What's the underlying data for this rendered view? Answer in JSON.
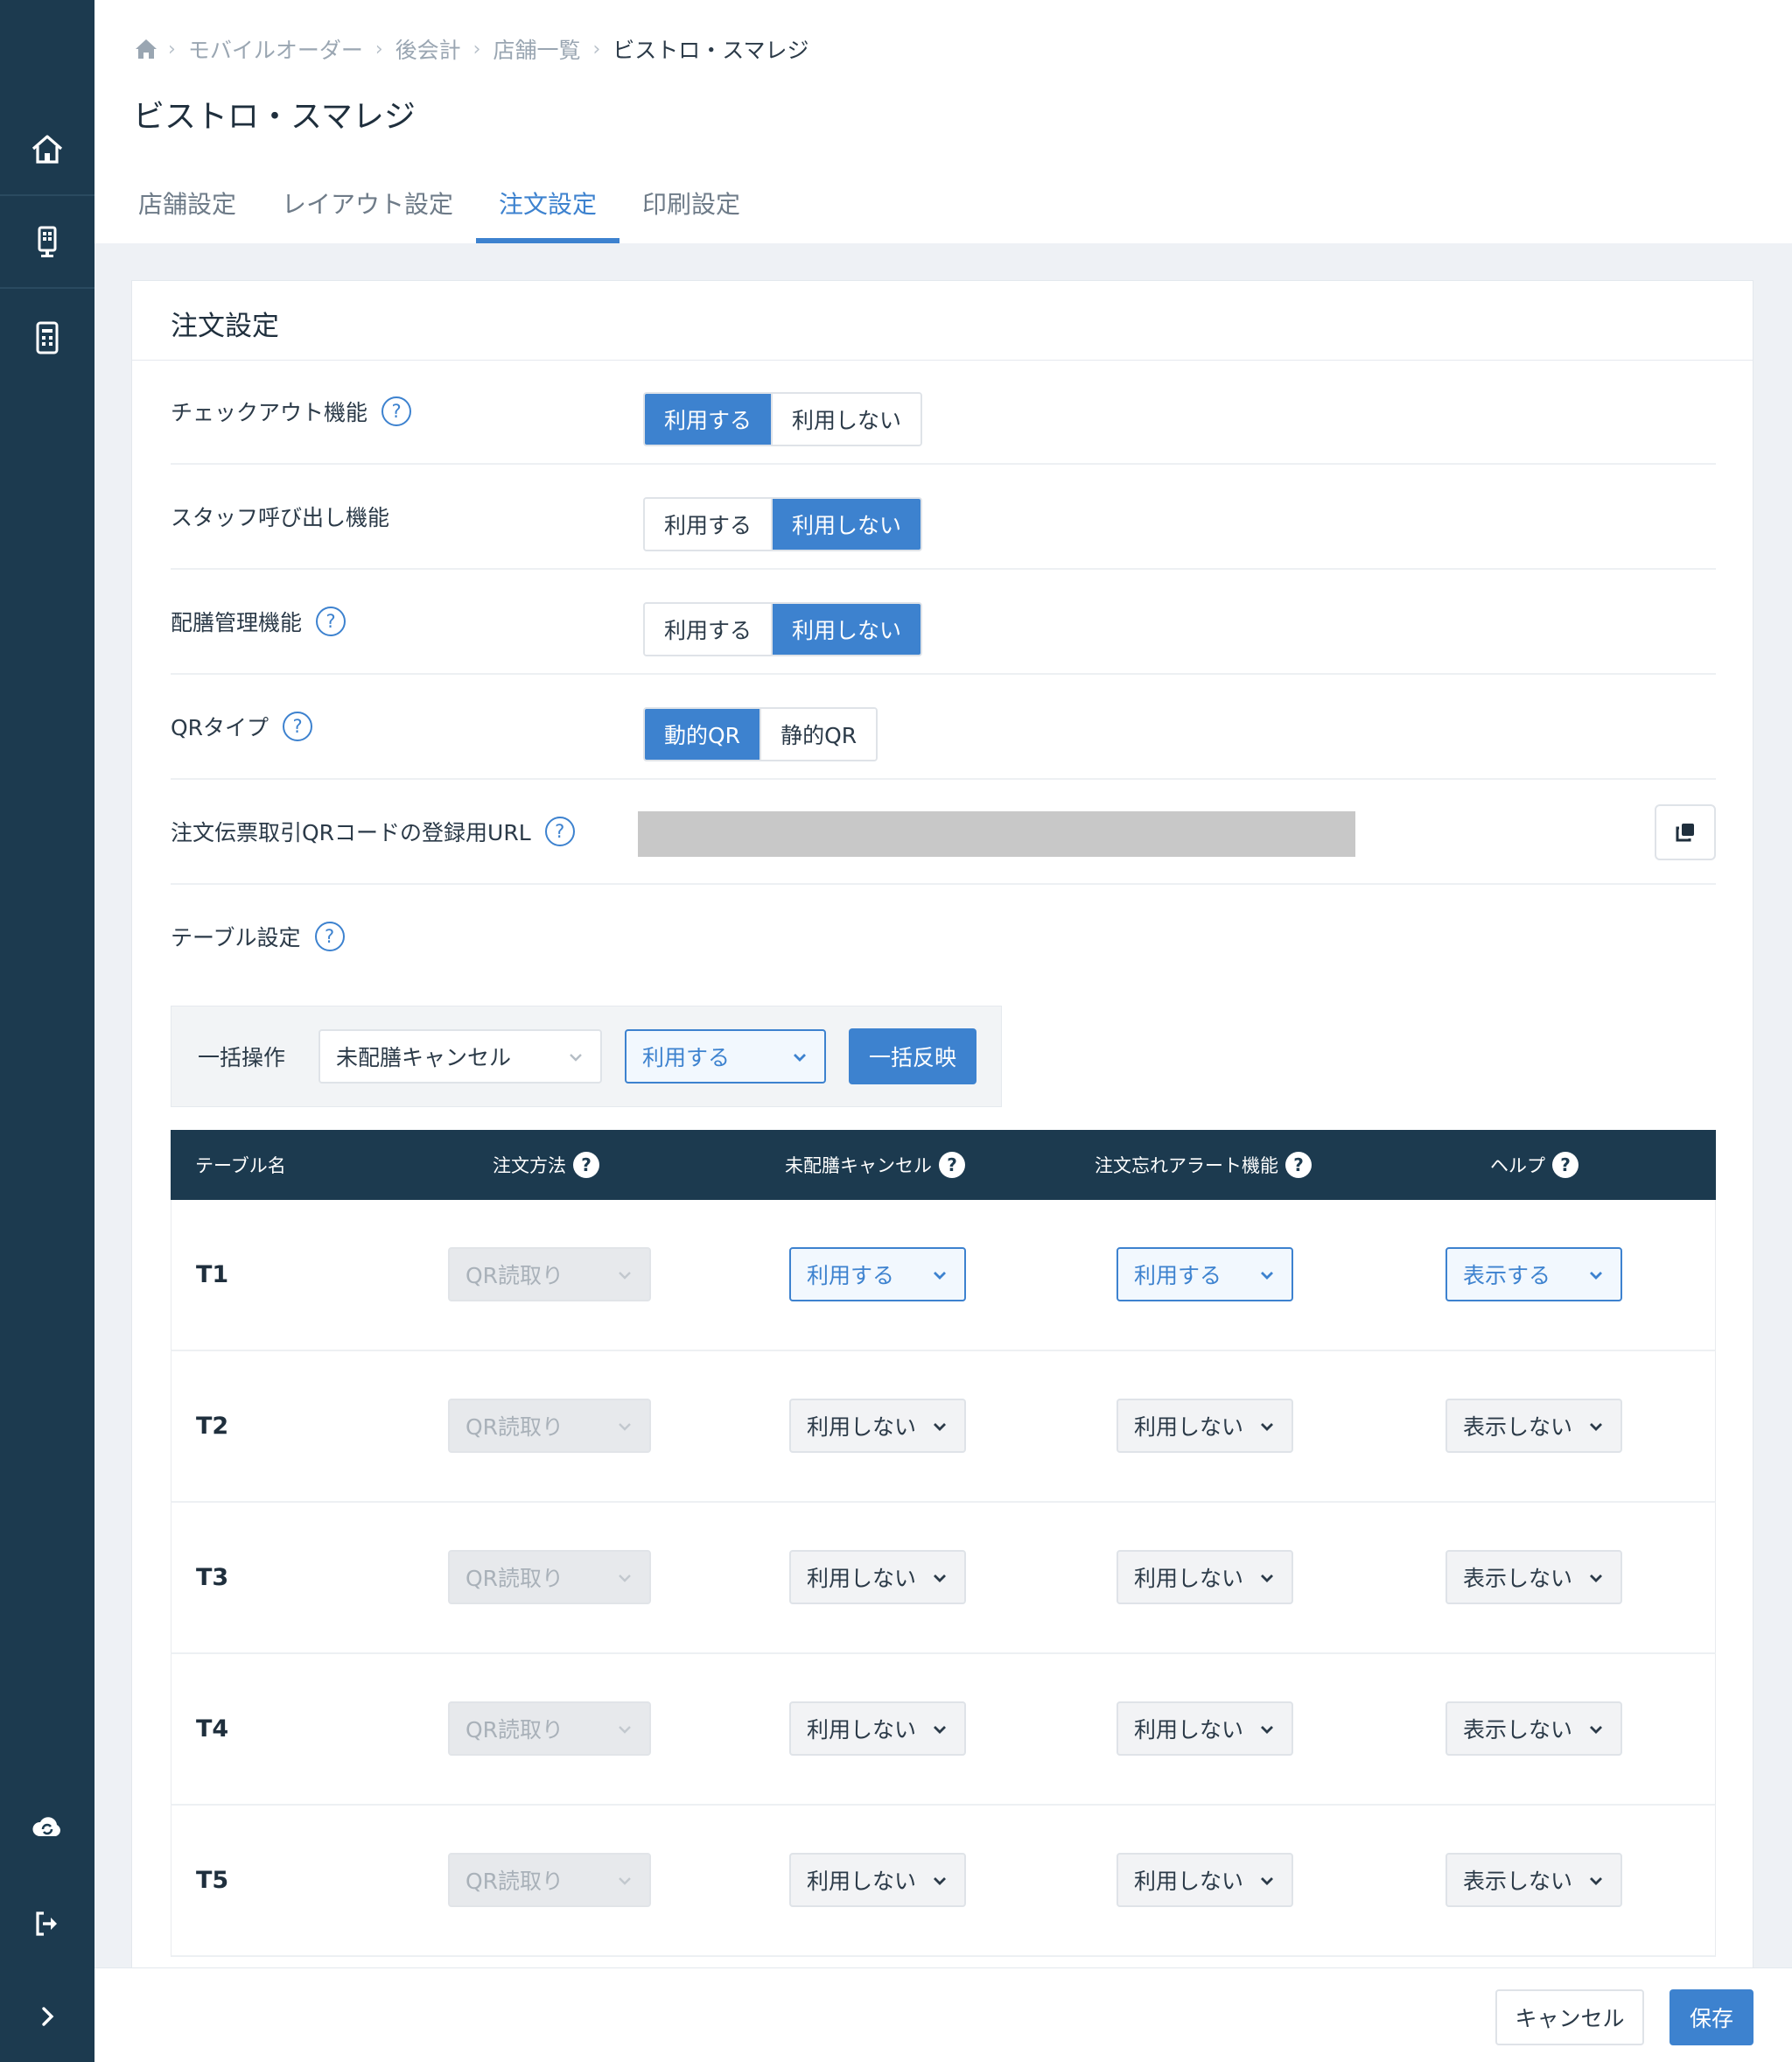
{
  "breadcrumb": [
    "モバイルオーダー",
    "後会計",
    "店舗一覧",
    "ビストロ・スマレジ"
  ],
  "page_title": "ビストロ・スマレジ",
  "tabs": [
    {
      "label": "店舗設定",
      "active": false
    },
    {
      "label": "レイアウト設定",
      "active": false
    },
    {
      "label": "注文設定",
      "active": true
    },
    {
      "label": "印刷設定",
      "active": false
    }
  ],
  "card_title": "注文設定",
  "settings": [
    {
      "label": "チェックアウト機能",
      "options": [
        "利用する",
        "利用しない"
      ],
      "selected": 0
    },
    {
      "label": "スタッフ呼び出し機能",
      "options": [
        "利用する",
        "利用しない"
      ],
      "selected": 1
    },
    {
      "label": "配膳管理機能",
      "options": [
        "利用する",
        "利用しない"
      ],
      "selected": 1
    },
    {
      "label": "QRタイプ",
      "options": [
        "動的QR",
        "静的QR"
      ],
      "selected": 0
    }
  ],
  "url_setting": {
    "label": "注文伝票取引QRコードの登録用URL"
  },
  "table_setting": {
    "label": "テーブル設定"
  },
  "bulk": {
    "label": "一括操作",
    "target": "未配膳キャンセル",
    "value": "利用する",
    "apply": "一括反映"
  },
  "table": {
    "headers": [
      "テーブル名",
      "注文方法",
      "未配膳キャンセル",
      "注文忘れアラート機能",
      "ヘルプ"
    ],
    "rows": [
      {
        "name": "T1",
        "method": "QR読取り",
        "cancel": "利用する",
        "alert": "利用する",
        "help": "表示する"
      },
      {
        "name": "T2",
        "method": "QR読取り",
        "cancel": "利用しない",
        "alert": "利用しない",
        "help": "表示しない"
      },
      {
        "name": "T3",
        "method": "QR読取り",
        "cancel": "利用しない",
        "alert": "利用しない",
        "help": "表示しない"
      },
      {
        "name": "T4",
        "method": "QR読取り",
        "cancel": "利用しない",
        "alert": "利用しない",
        "help": "表示しない"
      },
      {
        "name": "T5",
        "method": "QR読取り",
        "cancel": "利用しない",
        "alert": "利用しない",
        "help": "表示しない"
      }
    ]
  },
  "footer": {
    "cancel": "キャンセル",
    "save": "保存"
  },
  "help_glyph": "?",
  "colors": {
    "sidebar": "#1c3a4f",
    "accent": "#3d82cf"
  }
}
